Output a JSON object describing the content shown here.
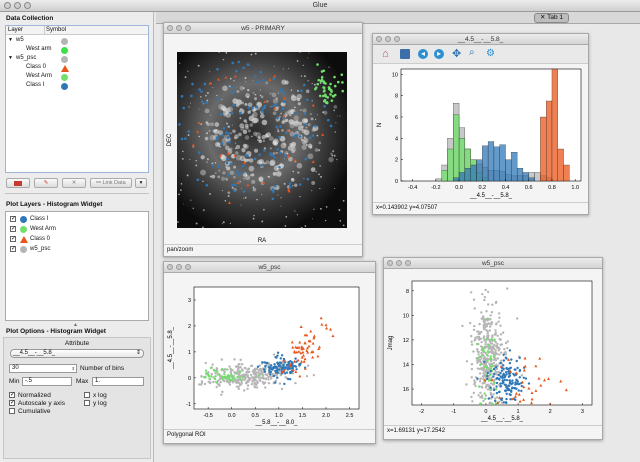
{
  "app": {
    "title": "Glue"
  },
  "tabs": [
    {
      "label": "Tab 1"
    }
  ],
  "data_collection": {
    "title": "Data Collection",
    "col_layer": "Layer",
    "col_symbol": "Symbol",
    "rows": [
      {
        "label": "w5",
        "kind": "group",
        "color": "#b5b5b5"
      },
      {
        "label": "West arm",
        "kind": "subset",
        "color": "#3ee04a"
      },
      {
        "label": "w5_psc",
        "kind": "group",
        "color": "#b5b5b5"
      },
      {
        "label": "Class 0",
        "kind": "subset-tri",
        "color": "#e8551b"
      },
      {
        "label": "West Arm",
        "kind": "subset",
        "color": "#70e06a"
      },
      {
        "label": "Class I",
        "kind": "subset",
        "color": "#2f78b8"
      }
    ],
    "link_button": "Link Data"
  },
  "plot_layers": {
    "title": "Plot Layers - Histogram Widget",
    "items": [
      {
        "label": "Class I",
        "color": "#2f78b8",
        "shape": "circle"
      },
      {
        "label": "West Arm",
        "color": "#70e06a",
        "shape": "circle"
      },
      {
        "label": "Class 0",
        "color": "#e8551b",
        "shape": "triangle"
      },
      {
        "label": "w5_psc",
        "color": "#b5b5b5",
        "shape": "circle"
      }
    ]
  },
  "plot_options": {
    "title": "Plot Options - Histogram Widget",
    "attribute_label": "Attribute",
    "attribute_value": "__4.5__-__5.8_",
    "bins_value": "30",
    "bins_label": "Number of bins",
    "min_label": "Min",
    "min_value": "-.5",
    "max_label": "Max",
    "max_value": "1.",
    "normalized": "Normalized",
    "autoscale": "Autoscale y axis",
    "cumulative": "Cumulative",
    "xlog": "x log",
    "ylog": "y log"
  },
  "windows": {
    "image": {
      "title": "w5 - PRIMARY",
      "xlabel": "RA",
      "ylabel": "DEC",
      "status": "pan/zoom"
    },
    "histogram": {
      "title": "__4.5__-__5.8_",
      "ylabel": "N",
      "status": "x=0.143902     y=4.07507"
    },
    "scatter1": {
      "title": "w5_psc",
      "status": "Polygonal ROI"
    },
    "scatter2": {
      "title": "w5_psc",
      "ylabel": "Jmag",
      "status": "x=1.69131     y=17.2542"
    }
  },
  "colors": {
    "class_i": "#2f78b8",
    "west_arm": "#70e06a",
    "class_0": "#e8551b",
    "w5_psc": "#b5b5b5"
  },
  "chart_data": [
    {
      "type": "bar",
      "title": "__4.5__-__5.8_",
      "ylabel": "N",
      "xlim": [
        -0.5,
        1.05
      ],
      "ylim": [
        0,
        10.5
      ],
      "xticks": [
        "-0.4",
        "-0.2",
        "0.0",
        "0.2",
        "0.4",
        "0.6",
        "0.8",
        "1.0"
      ],
      "yticks": [
        "0",
        "2",
        "4",
        "6",
        "8",
        "10"
      ],
      "bin_start": -0.5,
      "bin_width": 0.05,
      "series": [
        {
          "name": "w5_psc",
          "color": "#b5b5b5",
          "values": [
            0,
            0,
            0,
            0,
            0,
            0,
            0.2,
            1.5,
            4,
            7.3,
            5,
            3,
            2,
            1.6,
            1.3,
            1,
            1,
            0.9,
            0.6,
            0.5,
            0.5,
            0.5,
            0.8,
            0.8,
            0.5,
            0.3,
            0,
            0,
            0,
            0,
            0
          ]
        },
        {
          "name": "West Arm",
          "color": "#70e06a",
          "values": [
            0,
            0,
            0,
            0,
            0,
            0,
            0,
            1,
            3,
            6.2,
            4,
            3,
            2,
            0.8,
            0.3,
            0,
            0,
            0,
            0,
            0,
            0,
            0,
            0,
            0,
            0,
            0,
            0,
            0,
            0,
            0,
            0
          ]
        },
        {
          "name": "Class I",
          "color": "#2f78b8",
          "values": [
            0,
            0,
            0,
            0,
            0,
            0,
            0,
            0,
            0,
            0.3,
            0.8,
            1.2,
            1.5,
            2,
            3.3,
            3.7,
            3.2,
            3.4,
            2,
            2.7,
            1.2,
            0.8,
            0.3,
            0,
            0,
            0,
            0,
            0,
            0,
            0,
            0
          ]
        },
        {
          "name": "Class 0",
          "color": "#e8551b",
          "values": [
            0,
            0,
            0,
            0,
            0,
            0,
            0,
            0,
            0,
            0,
            0,
            0,
            0,
            0,
            0,
            0,
            0,
            0,
            0,
            0,
            0,
            0,
            0,
            0,
            6,
            7.5,
            10.5,
            3,
            1.5,
            0,
            0
          ]
        }
      ]
    },
    {
      "type": "scatter",
      "xlim": [
        -0.8,
        2.7
      ],
      "ylim": [
        -1.2,
        3.5
      ],
      "xticks": [
        "-0.5",
        "0.0",
        "0.5",
        "1.0",
        "1.5",
        "2.0",
        "2.5"
      ],
      "yticks": [
        "-1",
        "0",
        "1",
        "2",
        "3"
      ],
      "xlabel": "__5.8__-__8.0_",
      "ylabel": "__4.5__-__5.8_",
      "series": [
        {
          "name": "w5_psc",
          "color": "#b5b5b5",
          "shape": "circle",
          "center": [
            0.3,
            0.1
          ],
          "spread": [
            0.5,
            0.25
          ],
          "n": 320
        },
        {
          "name": "West Arm",
          "color": "#70e06a",
          "shape": "circle",
          "center": [
            -0.1,
            0.1
          ],
          "spread": [
            0.25,
            0.12
          ],
          "n": 40
        },
        {
          "name": "Class I",
          "color": "#2f78b8",
          "shape": "circle",
          "center": [
            1.05,
            0.4
          ],
          "spread": [
            0.2,
            0.2
          ],
          "n": 110
        },
        {
          "name": "Class 0",
          "color": "#e8551b",
          "shape": "triangle",
          "center": [
            1.6,
            1.3
          ],
          "spread": [
            0.25,
            0.55
          ],
          "n": 60
        }
      ]
    },
    {
      "type": "scatter",
      "xlim": [
        -2.3,
        3.3
      ],
      "ylim": [
        7.2,
        17.3
      ],
      "xticks": [
        "-2",
        "-1",
        "0",
        "1",
        "2",
        "3"
      ],
      "yticks": [
        "16",
        "14",
        "12",
        "10",
        "8"
      ],
      "ylabel": "Jmag",
      "xlabel": "__4.5__-__5.8_",
      "y_inverted": true,
      "series": [
        {
          "name": "w5_psc",
          "color": "#b5b5b5",
          "shape": "circle",
          "center": [
            0.1,
            13.5
          ],
          "spread": [
            0.25,
            2.3
          ],
          "n": 380
        },
        {
          "name": "West Arm",
          "color": "#70e06a",
          "shape": "circle",
          "center": [
            0.05,
            14.5
          ],
          "spread": [
            0.15,
            1.6
          ],
          "n": 45
        },
        {
          "name": "Class I",
          "color": "#2f78b8",
          "shape": "circle",
          "center": [
            0.65,
            15.3
          ],
          "spread": [
            0.25,
            0.9
          ],
          "n": 140
        },
        {
          "name": "Class 0",
          "color": "#e8551b",
          "shape": "triangle",
          "center": [
            1.2,
            15.5
          ],
          "spread": [
            0.55,
            1.1
          ],
          "n": 35
        }
      ]
    }
  ]
}
